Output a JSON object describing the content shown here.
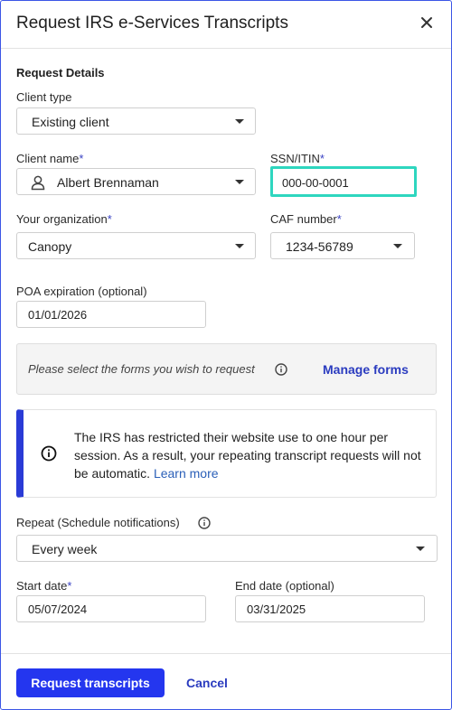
{
  "dialog": {
    "title": "Request IRS e-Services Transcripts"
  },
  "section": {
    "title": "Request Details"
  },
  "client_type": {
    "label": "Client type",
    "value": "Existing client"
  },
  "client_name": {
    "label": "Client name",
    "required": "*",
    "value": "Albert Brennaman"
  },
  "ssn": {
    "label": "SSN/ITIN",
    "required": "*",
    "value": "000-00-0001"
  },
  "organization": {
    "label": "Your organization",
    "required": "*",
    "value": "Canopy"
  },
  "caf": {
    "label": "CAF number",
    "required": "*",
    "value": "1234-56789"
  },
  "poa": {
    "label": "POA expiration (optional)",
    "value": "01/01/2026"
  },
  "forms": {
    "hint": "Please select the forms you wish to request",
    "manage": "Manage forms"
  },
  "banner": {
    "text": "The IRS has restricted their website use to one hour per session. As a result, your repeating transcript requests will not be automatic.",
    "link": "Learn more"
  },
  "repeat": {
    "label": "Repeat (Schedule notifications)",
    "value": "Every week"
  },
  "start_date": {
    "label": "Start date",
    "required": "*",
    "value": "05/07/2024"
  },
  "end_date": {
    "label": "End date (optional)",
    "value": "03/31/2025"
  },
  "footer": {
    "primary": "Request transcripts",
    "cancel": "Cancel"
  },
  "colors": {
    "primary": "#2436ef",
    "accent_border": "#2ed6bf",
    "banner_bar": "#2a3bd6",
    "link": "#2a3bbf"
  },
  "icons": {
    "close": "close-icon",
    "user": "user-icon",
    "info": "info-icon",
    "dropdown": "chevron-down-icon"
  }
}
